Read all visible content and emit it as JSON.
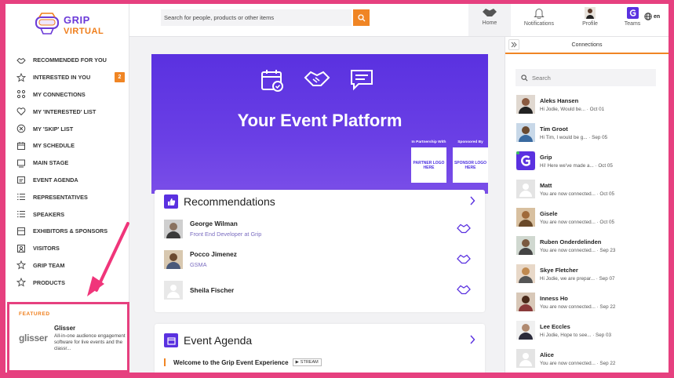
{
  "brand": {
    "line1": "GRIP",
    "line2": "VIRTUAL"
  },
  "sidebar": {
    "items": [
      {
        "label": "RECOMMENDED FOR YOU",
        "icon": "handshake-icon"
      },
      {
        "label": "INTERESTED IN YOU",
        "icon": "star-icon",
        "badge": "2"
      },
      {
        "label": "MY CONNECTIONS",
        "icon": "connections-icon"
      },
      {
        "label": "MY 'INTERESTED' LIST",
        "icon": "heart-icon"
      },
      {
        "label": "MY 'SKIP' LIST",
        "icon": "skip-icon"
      },
      {
        "label": "MY SCHEDULE",
        "icon": "calendar-icon"
      },
      {
        "label": "MAIN STAGE",
        "icon": "stage-icon"
      },
      {
        "label": "EVENT AGENDA",
        "icon": "agenda-icon"
      },
      {
        "label": "REPRESENTATIVES",
        "icon": "list-icon"
      },
      {
        "label": "SPEAKERS",
        "icon": "list-icon"
      },
      {
        "label": "EXHIBITORS & SPONSORS",
        "icon": "exhibitor-icon"
      },
      {
        "label": "VISITORS",
        "icon": "visitors-icon"
      },
      {
        "label": "GRIP TEAM",
        "icon": "star-icon"
      },
      {
        "label": "PRODUCTS",
        "icon": "star-icon"
      }
    ],
    "featured": {
      "title": "FEATURED",
      "logo_text": "glisser",
      "name": "Glisser",
      "description": "All-in-one audience engagement software for live events and the classr..."
    }
  },
  "topbar": {
    "search_placeholder": "Search for people, products or other items",
    "nav": [
      {
        "label": "Home",
        "icon": "handshake-icon"
      },
      {
        "label": "Notifications",
        "icon": "bell-icon"
      },
      {
        "label": "Profile",
        "icon": "profile-avatar"
      },
      {
        "label": "Teams",
        "icon": "grip-logo-icon"
      }
    ],
    "lang": "en"
  },
  "hero": {
    "title": "Your Event Platform",
    "partner_label": "In Partnership With",
    "partner_box": "PARTNER LOGO HERE",
    "sponsor_label": "Sponsored By",
    "sponsor_box": "SPONSOR LOGO HERE"
  },
  "recommendations": {
    "title": "Recommendations",
    "items": [
      {
        "name": "George Wilman",
        "sub": "Front End Developer at Grip"
      },
      {
        "name": "Pocco Jimenez",
        "sub": "GSMA"
      },
      {
        "name": "Sheila Fischer",
        "sub": ""
      }
    ]
  },
  "agenda": {
    "title": "Event Agenda",
    "first_item": "Welcome to the Grip Event Experience",
    "stream_tag": "STREAM"
  },
  "connections": {
    "title": "Connections",
    "search_placeholder": "Search",
    "items": [
      {
        "name": "Aleks Hansen",
        "msg": "Hi Jodie, Would be...  · Oct 01"
      },
      {
        "name": "Tim Groot",
        "msg": "Hi Tim, I would be g...  · Sep 05"
      },
      {
        "name": "Grip",
        "msg": "Hi! Here we've made a...  · Oct 05"
      },
      {
        "name": "Matt",
        "msg": "You are now connected...  · Oct 05"
      },
      {
        "name": "Gisele",
        "msg": "You are now connected...  · Oct 05"
      },
      {
        "name": "Ruben Onderdelinden",
        "msg": "You are now connected...  · Sep 23"
      },
      {
        "name": "Skye Fletcher",
        "msg": "Hi Jodie, we are prepar...  · Sep 07"
      },
      {
        "name": "Inness Ho",
        "msg": "You are now connected...  · Sep 22"
      },
      {
        "name": "Lee Eccles",
        "msg": "Hi Jodie, Hope to see...  · Sep 03"
      },
      {
        "name": "Alice",
        "msg": "You are now connected...  · Sep 22"
      }
    ]
  },
  "colors": {
    "accent": "#f08524",
    "brand": "#5a31e0",
    "border_highlight": "#e6407f"
  }
}
